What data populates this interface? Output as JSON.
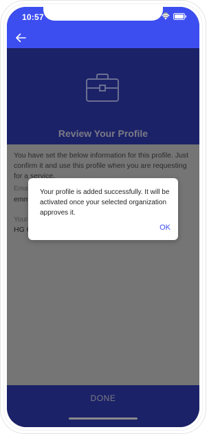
{
  "status_bar": {
    "time": "10:57",
    "icons": [
      "wifi-icon",
      "battery-icon"
    ]
  },
  "header": {
    "back_icon": "arrow-left-icon",
    "color": "#3d4ef0"
  },
  "hero": {
    "icon": "briefcase-icon",
    "title": "Review Your Profile",
    "background": "#1c2268"
  },
  "content": {
    "intro": "You have set the below information for this profile. Just confirm it and use this profile when you are requesting for a service.",
    "fields": [
      {
        "label": "Ema",
        "value": "emm"
      },
      {
        "label": "Your",
        "value": "HG C"
      }
    ]
  },
  "footer": {
    "done_label": "DONE"
  },
  "dialog": {
    "message": "Your profile is added successfully. It will be activated once your selected organization approves it.",
    "ok_label": "OK",
    "accent": "#3d4ef0"
  }
}
